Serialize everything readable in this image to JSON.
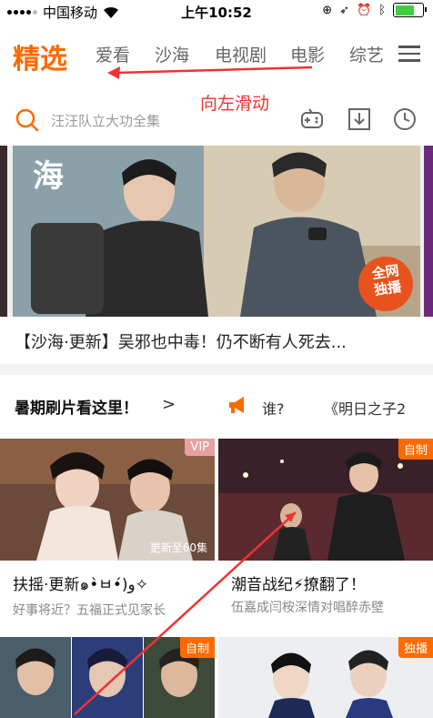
{
  "status_bar": {
    "carrier": "中国移动",
    "time": "上午10:52",
    "battery_level": 0.7
  },
  "tabs": {
    "active": "精选",
    "items": [
      "爱看",
      "沙海",
      "电视剧",
      "电影",
      "综艺"
    ]
  },
  "annotation": "向左滑动",
  "search": {
    "placeholder": "汪汪队立大功全集"
  },
  "banner": {
    "caption": "【沙海·更新】吴邪也中毒！仍不断有人死去...",
    "logo_text": "全网\n独播",
    "poster_char": "海"
  },
  "summer": {
    "title": "暑期刷片看这里！",
    "chevron": ">",
    "ticker_1": "谁?",
    "ticker_2": "《明日之子2"
  },
  "cards": [
    {
      "badge": "VIP",
      "overlay": "更新至60集",
      "title": "扶摇·更新๑•̀ㅂ•́)و✧",
      "subtitle": "好事将近？五福正式见家长"
    },
    {
      "badge": "自制",
      "overlay": "",
      "title": "潮音战纪⚡撩翻了！",
      "subtitle": "伍嘉成闫桉深情对唱醉赤壁"
    },
    {
      "badge": "自制"
    },
    {
      "badge": "独播"
    }
  ],
  "colors": {
    "accent": "#ff6a00",
    "annotation": "#e33333"
  }
}
